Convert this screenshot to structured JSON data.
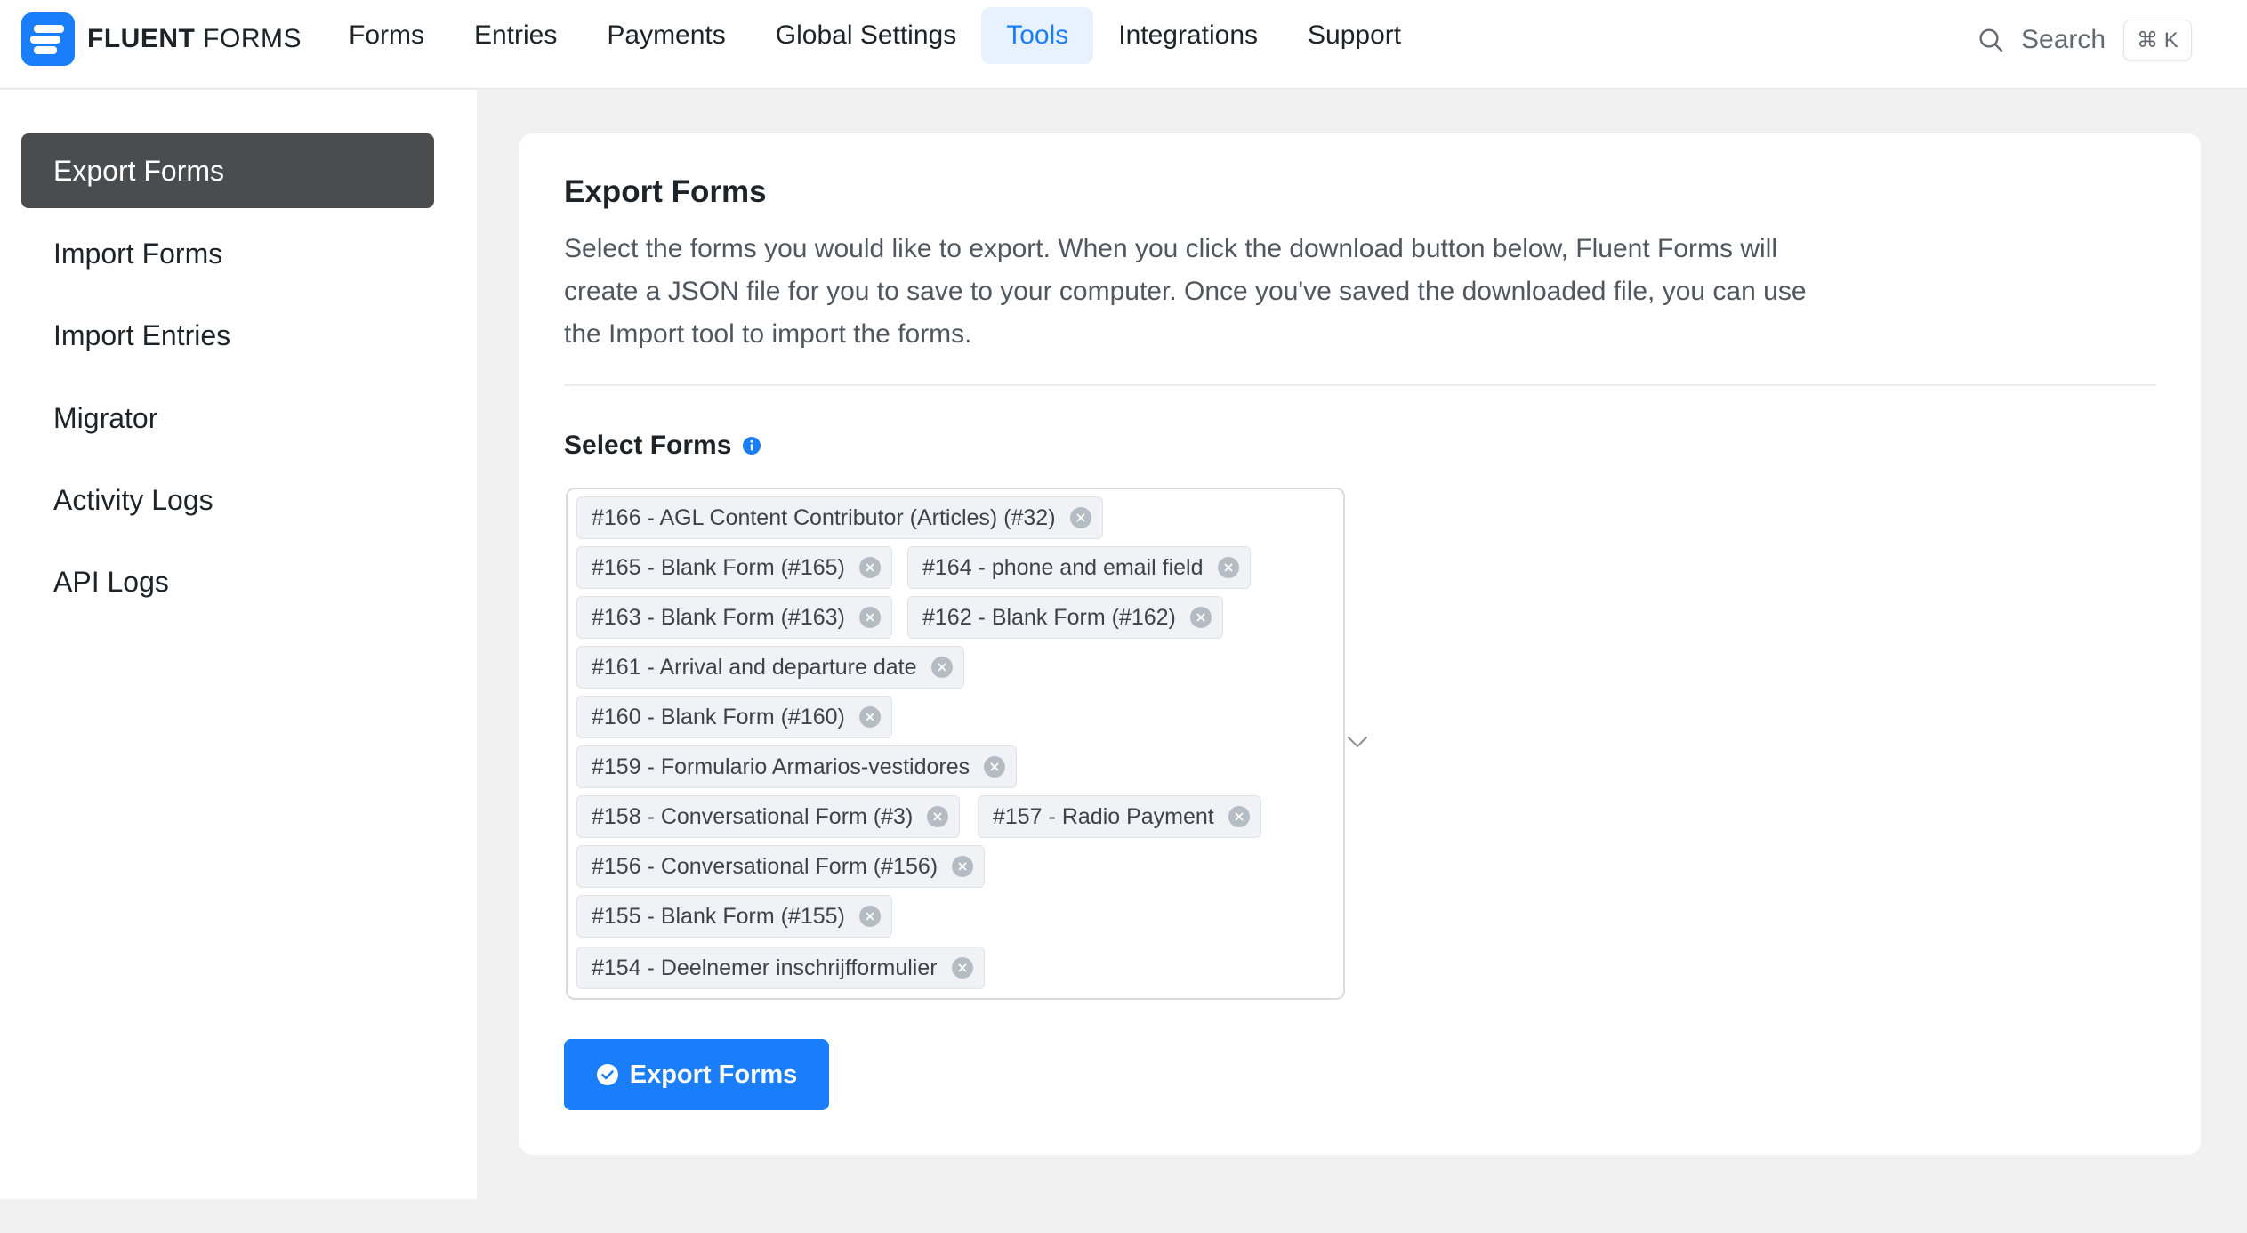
{
  "brand": {
    "name_bold": "FLUENT",
    "name_light": " FORMS"
  },
  "nav": {
    "items": [
      {
        "label": "Forms"
      },
      {
        "label": "Entries"
      },
      {
        "label": "Payments"
      },
      {
        "label": "Global Settings"
      },
      {
        "label": "Tools",
        "active": true
      },
      {
        "label": "Integrations"
      },
      {
        "label": "Support"
      }
    ]
  },
  "search": {
    "label": "Search",
    "shortcut": "⌘ K"
  },
  "sidebar": {
    "items": [
      {
        "label": "Export Forms",
        "active": true
      },
      {
        "label": "Import Forms"
      },
      {
        "label": "Import Entries"
      },
      {
        "label": "Migrator"
      },
      {
        "label": "Activity Logs"
      },
      {
        "label": "API Logs"
      }
    ]
  },
  "main": {
    "title": "Export Forms",
    "description": "Select the forms you would like to export. When you click the download button below, Fluent Forms will create a JSON file for you to save to your computer. Once you've saved the downloaded file, you can use the Import tool to import the forms.",
    "select_label": "Select Forms",
    "selected_forms": [
      "#166 - AGL Content Contributor (Articles) (#32)",
      "#165 - Blank Form (#165)",
      "#164 - phone and email field",
      "#163 - Blank Form (#163)",
      "#162 - Blank Form (#162)",
      "#161 - Arrival and departure date",
      "#160 - Blank Form (#160)",
      "#159 - Formulario Armarios-vestidores",
      "#158 - Conversational Form (#3)",
      "#157 - Radio Payment",
      "#156 - Conversational Form (#156)",
      "#155 - Blank Form (#155)",
      "#154 - Deelnemer inschrijfformulier"
    ],
    "export_button": "Export Forms"
  },
  "colors": {
    "accent": "#1a7efb",
    "sidebar_active": "#4b4c4d",
    "nav_active_bg": "#e8f1fe"
  }
}
